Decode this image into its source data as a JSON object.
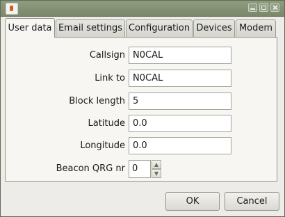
{
  "window": {
    "icon": "java-cup-icon",
    "controls": [
      "minimize-icon",
      "maximize-icon",
      "close-icon"
    ]
  },
  "tabs": [
    {
      "label": "User data",
      "active": true
    },
    {
      "label": "Email settings",
      "active": false
    },
    {
      "label": "Configuration",
      "active": false
    },
    {
      "label": "Devices",
      "active": false
    },
    {
      "label": "Modem",
      "active": false
    }
  ],
  "form": {
    "callsign": {
      "label": "Callsign",
      "value": "N0CAL"
    },
    "link_to": {
      "label": "Link to",
      "value": "N0CAL"
    },
    "block_length": {
      "label": "Block length",
      "value": "5"
    },
    "latitude": {
      "label": "Latitude",
      "value": "0.0"
    },
    "longitude": {
      "label": "Longitude",
      "value": "0.0"
    },
    "beacon_qrg": {
      "label": "Beacon QRG nr",
      "value": "0"
    }
  },
  "buttons": {
    "ok": "OK",
    "cancel": "Cancel"
  },
  "colors": {
    "titlebar": "#7a8769",
    "panel": "#f7f6f3",
    "window": "#edece8"
  }
}
